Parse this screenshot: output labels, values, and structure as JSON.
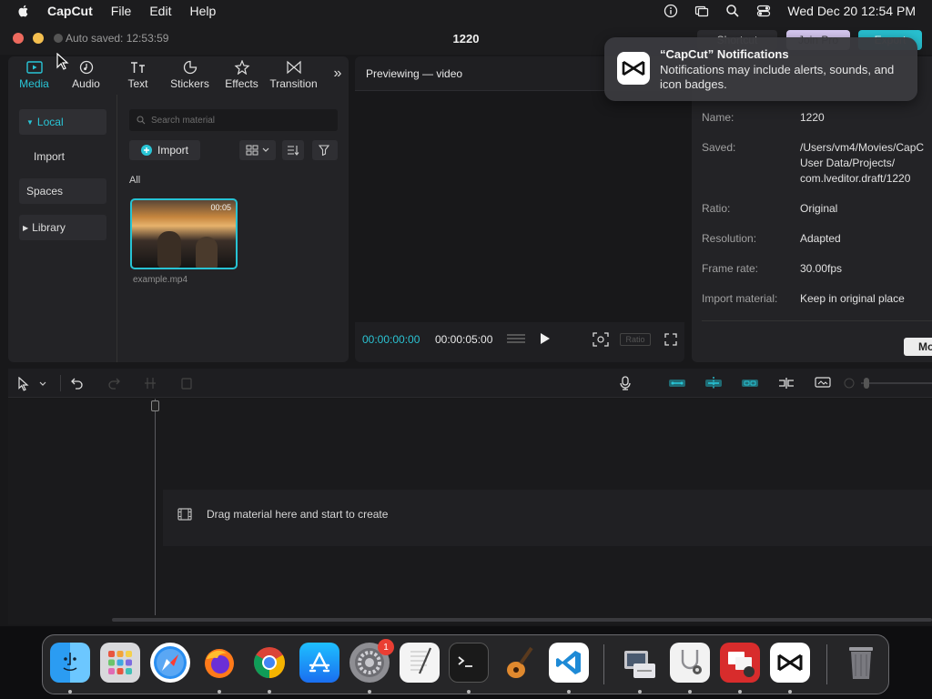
{
  "menubar": {
    "app_name": "CapCut",
    "menus": [
      "File",
      "Edit",
      "Help"
    ],
    "clock": "Wed Dec 20  12:54 PM"
  },
  "window": {
    "autosave": "Auto saved: 12:53:59",
    "title": "1220",
    "shortcut_label": "Shortcut",
    "join_pro_label": "Join Pro",
    "export_label": "Export"
  },
  "tabs": [
    {
      "label": "Media",
      "icon": "media-icon"
    },
    {
      "label": "Audio",
      "icon": "audio-icon"
    },
    {
      "label": "Text",
      "icon": "text-icon"
    },
    {
      "label": "Stickers",
      "icon": "stickers-icon"
    },
    {
      "label": "Effects",
      "icon": "effects-icon"
    },
    {
      "label": "Transition",
      "icon": "transition-icon"
    }
  ],
  "sidebar": {
    "items": [
      "Local",
      "Import",
      "Spaces",
      "Library"
    ]
  },
  "media": {
    "search_placeholder": "Search material",
    "import_label": "Import",
    "section_label": "All",
    "clip_name": "example.mp4",
    "clip_duration": "00:05"
  },
  "preview": {
    "header": "Previewing — video",
    "time_current": "00:00:00:00",
    "time_total": "00:00:05:00",
    "ratio_label": "Ratio"
  },
  "details": {
    "rows": [
      {
        "label": "Name:",
        "value": "1220"
      },
      {
        "label": "Saved:",
        "value": "/Users/vm4/Movies/CapC\nUser Data/Projects/\ncom.lveditor.draft/1220"
      },
      {
        "label": "Ratio:",
        "value": "Original"
      },
      {
        "label": "Resolution:",
        "value": "Adapted"
      },
      {
        "label": "Frame rate:",
        "value": "30.00fps"
      },
      {
        "label": "Import material:",
        "value": "Keep in original place"
      }
    ],
    "modify_label": "Mo"
  },
  "timeline": {
    "drop_hint": "Drag material here and start to create"
  },
  "notification": {
    "title": "“CapCut” Notifications",
    "body": "Notifications may include alerts, sounds, and icon badges."
  },
  "dock": {
    "apps": [
      "Finder",
      "Launchpad",
      "Safari",
      "Firefox",
      "Chrome",
      "App Store",
      "System Settings",
      "TextEdit",
      "Terminal",
      "GarageBand",
      "Visual Studio Code",
      "Migration Assistant",
      "System Information",
      "Photo Booth",
      "CapCut",
      "Trash"
    ],
    "settings_badge": "1"
  },
  "colors": {
    "accent": "#29c5d6",
    "notification_bg": "#3a3a3e",
    "panel_bg": "#232326"
  }
}
